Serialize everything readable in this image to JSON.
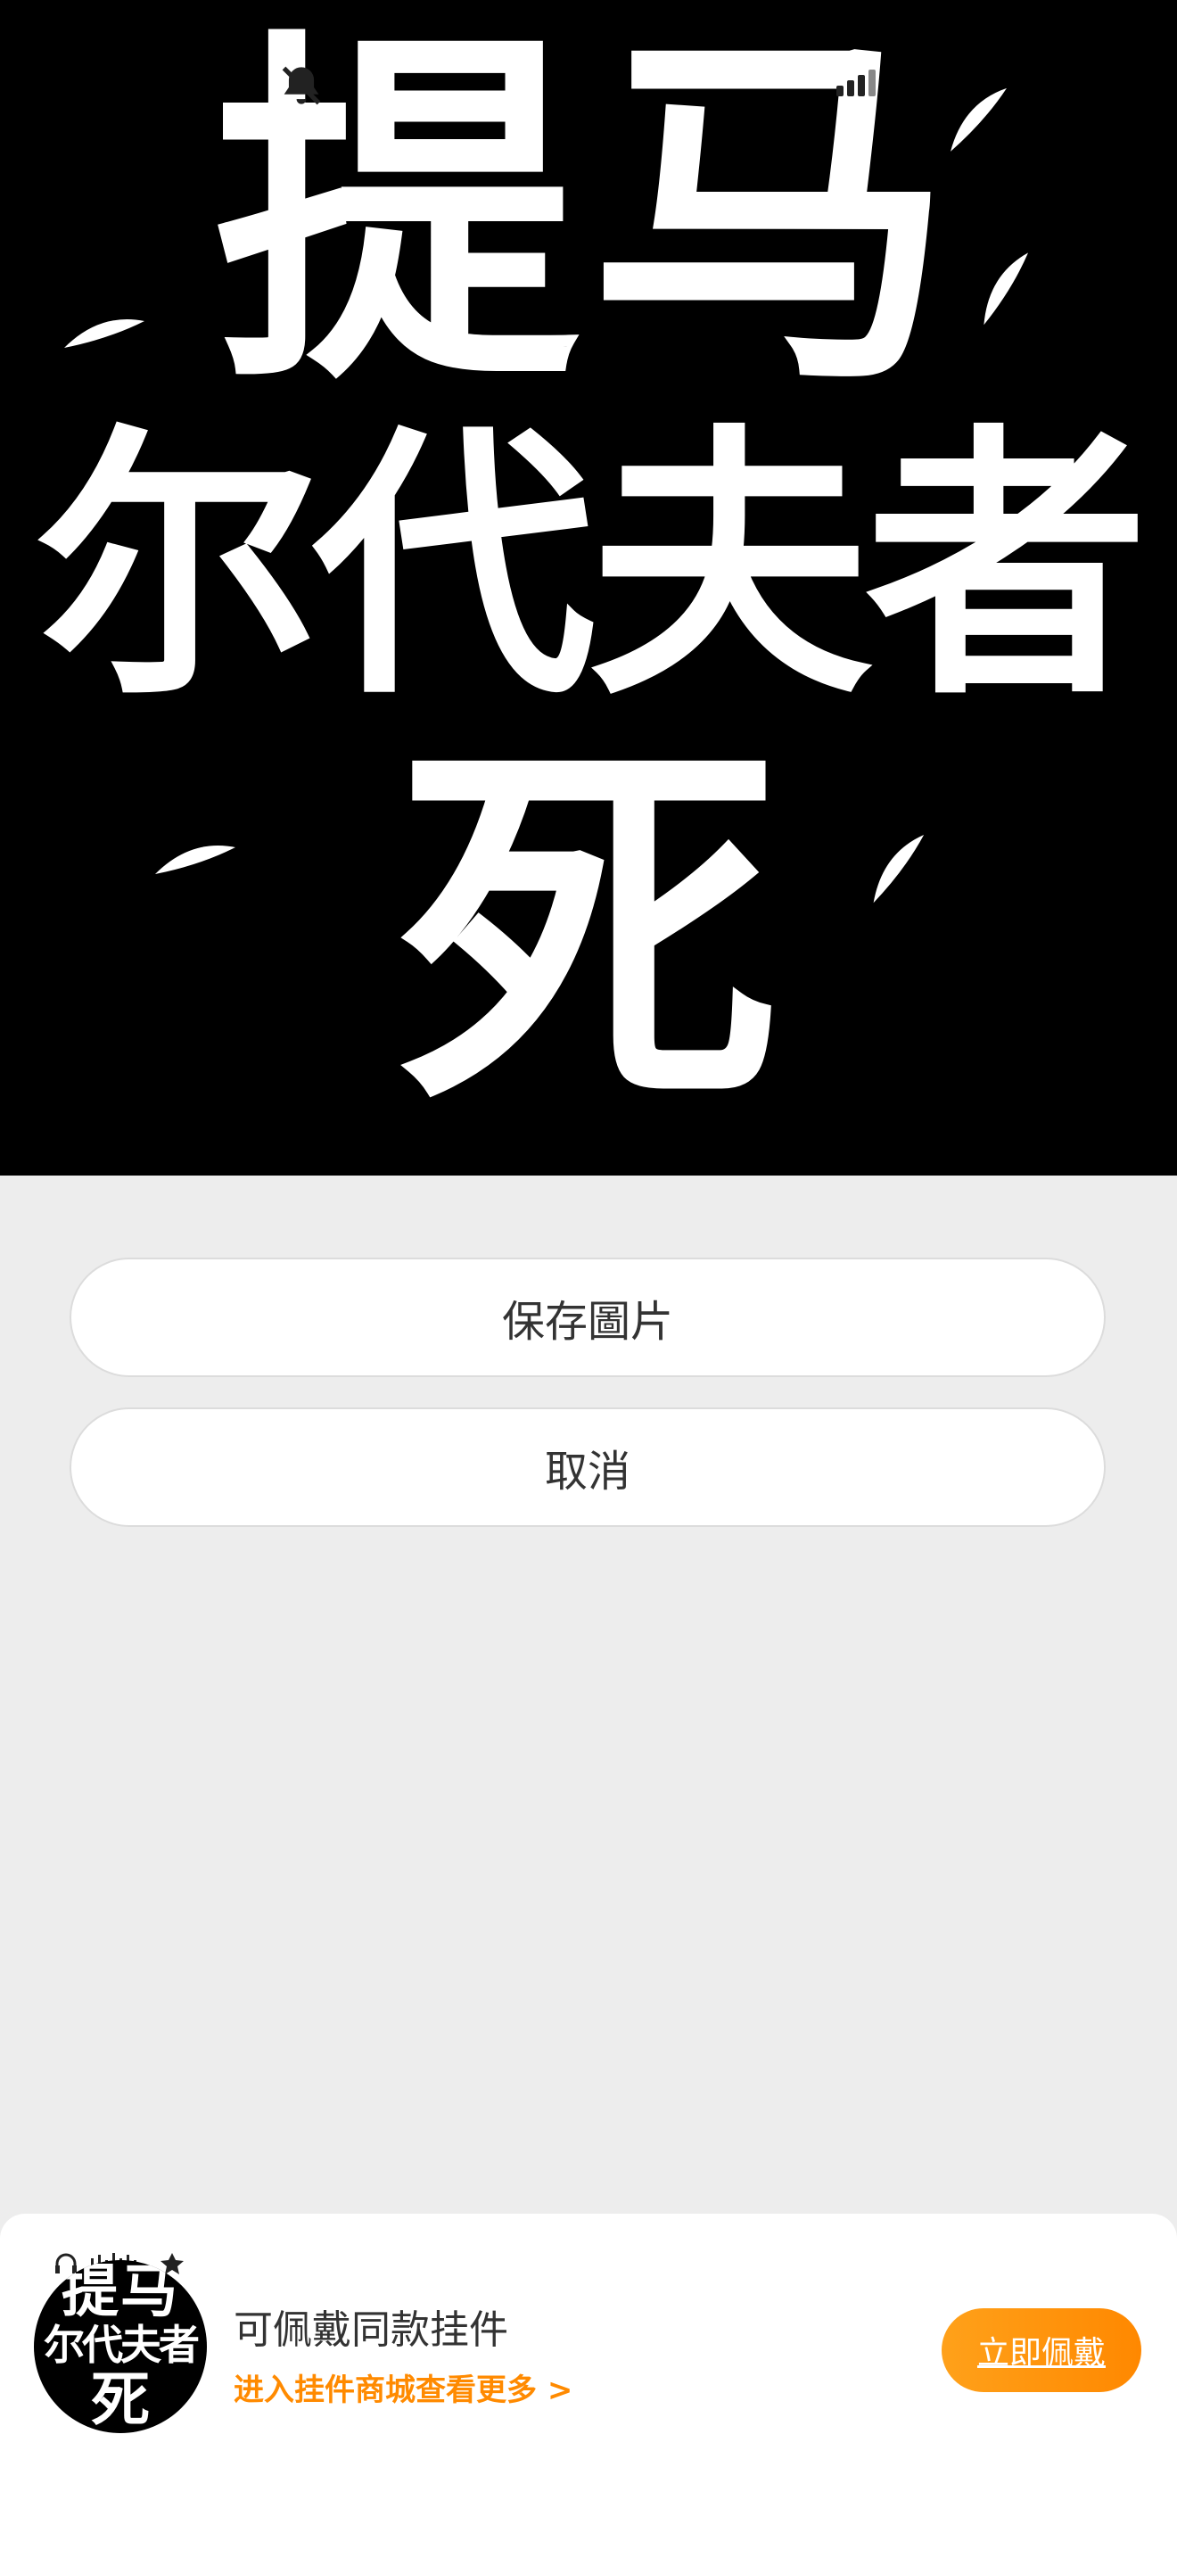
{
  "hero": {
    "line1": "提马",
    "line2": "尔代夫者",
    "line3": "死"
  },
  "status_bar": {
    "bell_icon": "bell-slash-icon",
    "signal_icon": "signal-icon"
  },
  "sheet": {
    "save_label": "保存圖片",
    "cancel_label": "取消"
  },
  "card": {
    "avatar": {
      "line1": "提马",
      "line2": "尔代夫者",
      "line3": "死"
    },
    "title": "可佩戴同款挂件",
    "subtitle": "进入挂件商城查看更多 >",
    "wear_label": "立即佩戴"
  },
  "colors": {
    "accent": "#ff8a00",
    "background": "#ededed",
    "hero_bg": "#000000"
  }
}
